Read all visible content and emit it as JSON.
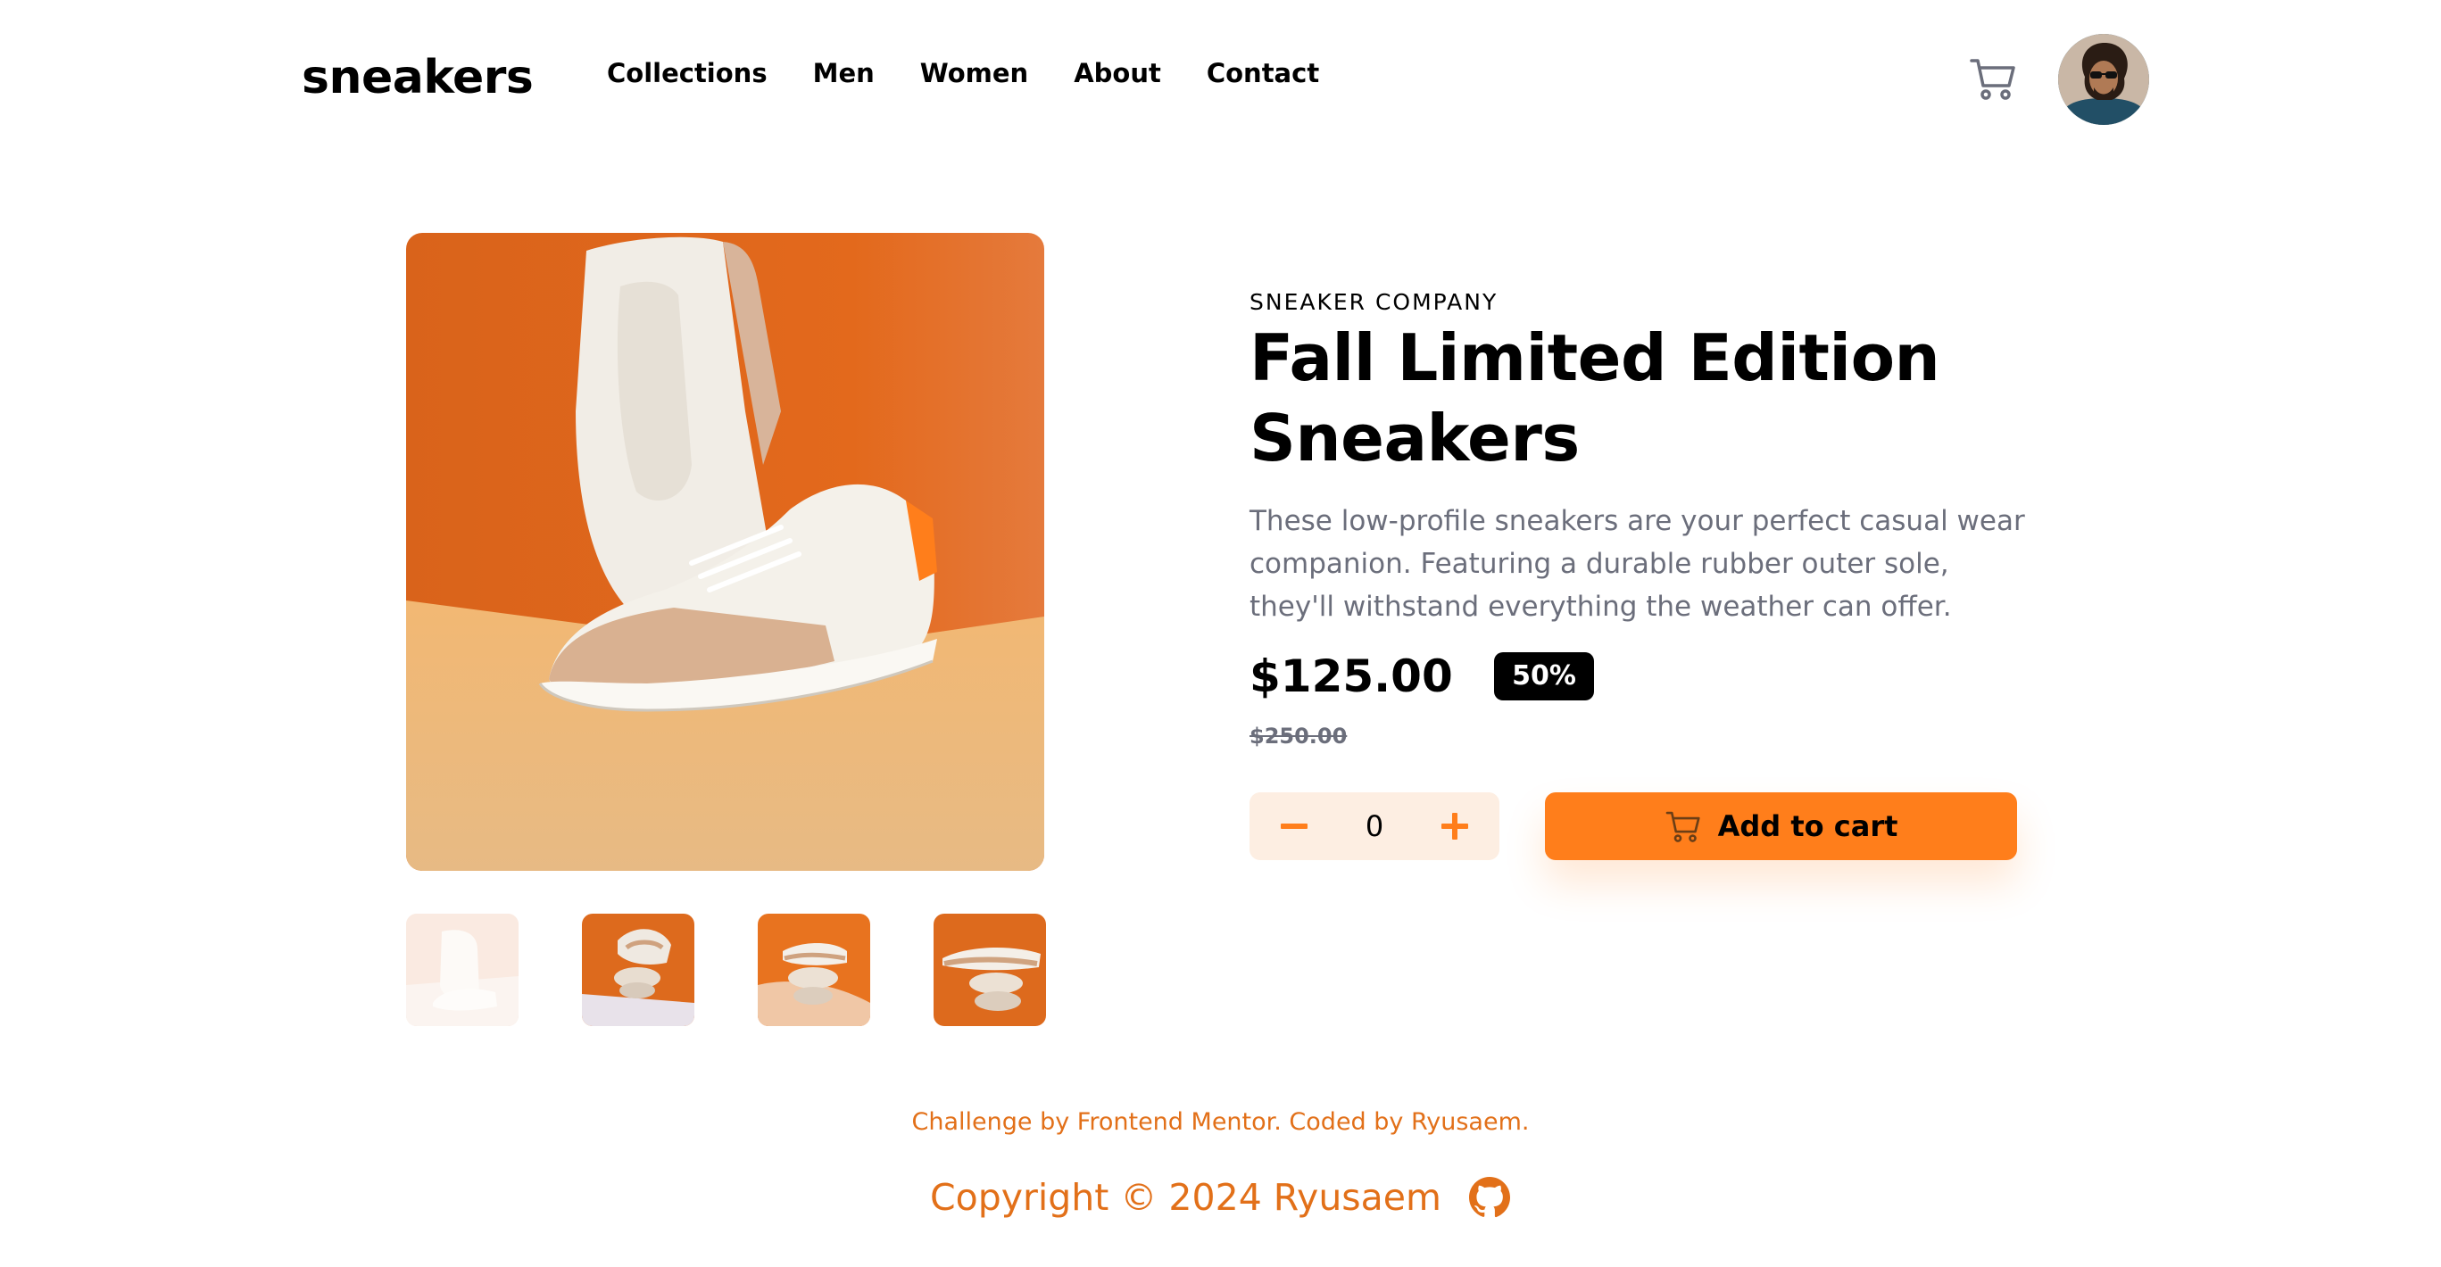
{
  "header": {
    "logo": "sneakers",
    "nav": [
      "Collections",
      "Men",
      "Women",
      "About",
      "Contact"
    ],
    "cart_icon": "cart-icon",
    "avatar_icon": "user-avatar"
  },
  "gallery": {
    "thumbnail_count": 4
  },
  "product": {
    "company": "SNEAKER COMPANY",
    "title": "Fall Limited Edition Sneakers",
    "description": "These low-profile sneakers are your perfect casual wear companion. Featuring a durable rubber outer sole, they'll withstand everything the weather can offer.",
    "price": "$125.00",
    "discount": "50%",
    "original_price": "$250.00",
    "quantity": "0",
    "add_to_cart_label": "Add to cart"
  },
  "footer": {
    "attribution_prefix": "Challenge by ",
    "attribution_link1": "Frontend Mentor",
    "attribution_middle": ". Coded by ",
    "attribution_link2": "Ryusaem",
    "attribution_suffix": ".",
    "copyright": "Copyright © 2024 Ryusaem",
    "github_icon": "github-icon"
  },
  "colors": {
    "accent": "#ff7e1b",
    "accent_pale": "#fdeee2",
    "text_muted": "#6b6e7b",
    "footer_text": "#e27019"
  }
}
